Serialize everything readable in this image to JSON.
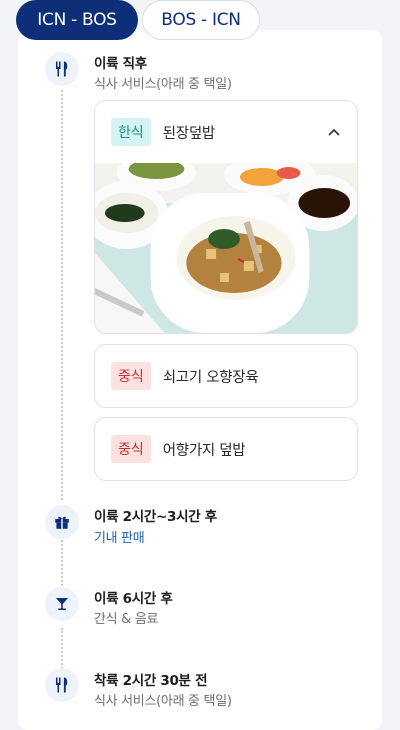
{
  "tabs": [
    {
      "label": "ICN - BOS",
      "active": true
    },
    {
      "label": "BOS - ICN",
      "active": false
    }
  ],
  "timeline": [
    {
      "icon": "utensils-icon",
      "title": "이륙 직후",
      "subtitle": "식사 서비스(아래 중 택일)"
    },
    {
      "icon": "gift-icon",
      "title": "이륙 2시간~3시간 후",
      "subtitle": "기내 판매"
    },
    {
      "icon": "cocktail-glass-icon",
      "title": "이륙 6시간 후",
      "subtitle": "간식 & 음료"
    },
    {
      "icon": "utensils-icon",
      "title": "착륙 2시간 30분 전",
      "subtitle": "식사 서비스(아래 중 택일)"
    }
  ],
  "meals": [
    {
      "badge": "한식",
      "name": "된장덮밥",
      "expanded": true,
      "image": "bibimbap-tray-photo"
    },
    {
      "badge": "중식",
      "name": "쇠고기 오향장육",
      "expanded": false
    },
    {
      "badge": "중식",
      "name": "어향가지 덮밥",
      "expanded": false
    }
  ],
  "colors": {
    "accent": "#0d2f77",
    "link": "#1b62b4",
    "korean_badge_bg": "#d4f3f2",
    "korean_badge_text": "#1a8f8f",
    "chinese_badge_bg": "#fde1e1",
    "chinese_badge_text": "#c33232"
  }
}
